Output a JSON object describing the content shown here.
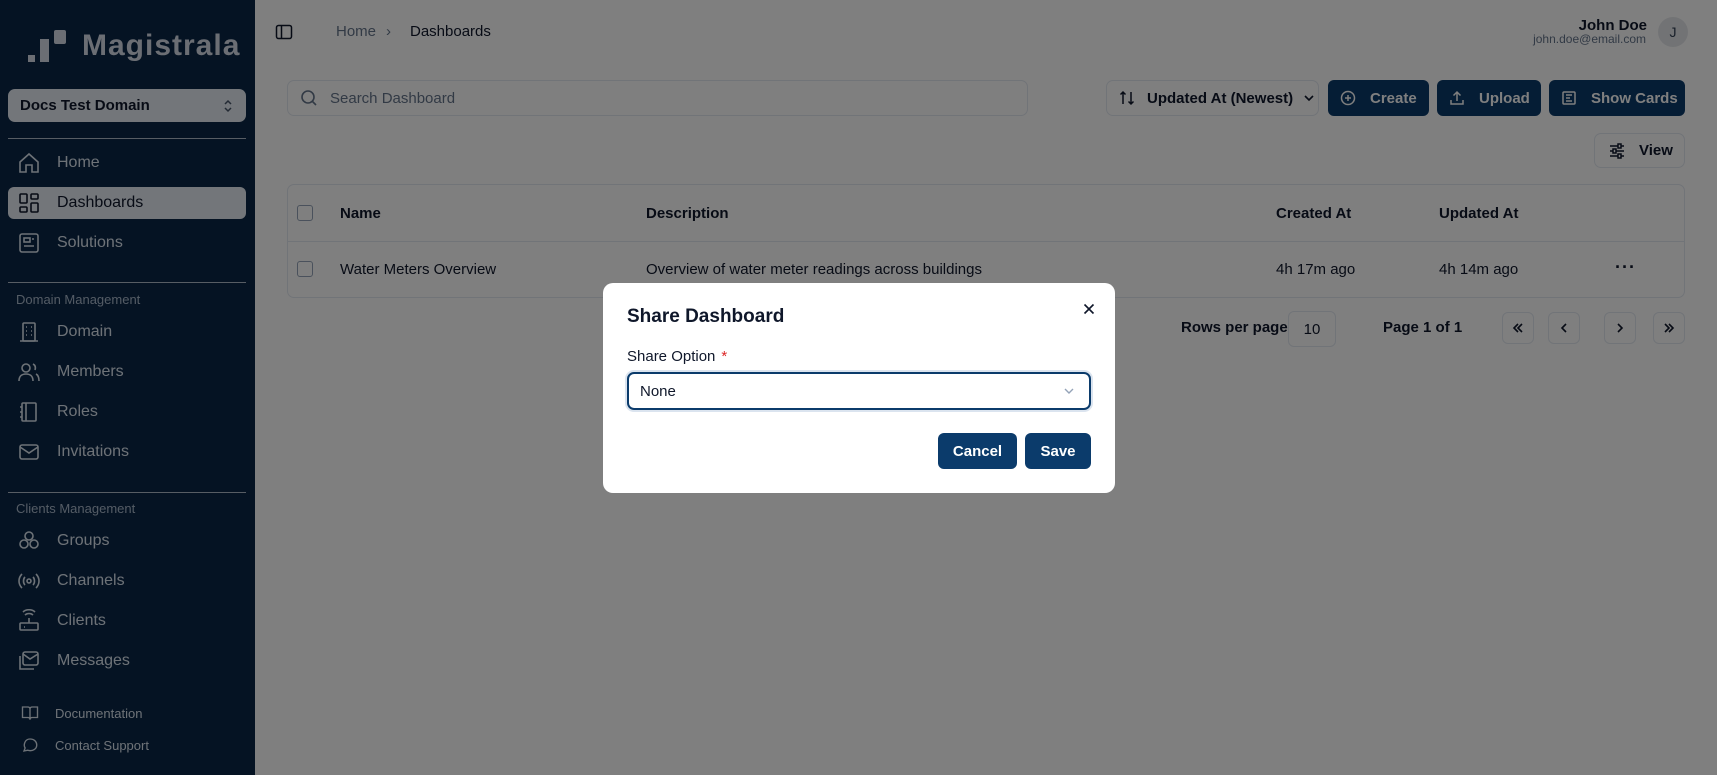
{
  "app": {
    "name": "Magistrala"
  },
  "sidebar": {
    "domain": "Docs Test Domain",
    "items": [
      {
        "label": "Home",
        "icon": "home-icon",
        "active": false
      },
      {
        "label": "Dashboards",
        "icon": "dashboard-icon",
        "active": true
      },
      {
        "label": "Solutions",
        "icon": "solutions-icon",
        "active": false
      }
    ],
    "domain_group": {
      "label": "Domain Management",
      "items": [
        {
          "label": "Domain",
          "icon": "building-icon"
        },
        {
          "label": "Members",
          "icon": "users-icon"
        },
        {
          "label": "Roles",
          "icon": "roles-icon"
        },
        {
          "label": "Invitations",
          "icon": "mail-icon"
        }
      ]
    },
    "clients_group": {
      "label": "Clients Management",
      "items": [
        {
          "label": "Groups",
          "icon": "groups-icon"
        },
        {
          "label": "Channels",
          "icon": "radio-icon"
        },
        {
          "label": "Clients",
          "icon": "router-icon"
        },
        {
          "label": "Messages",
          "icon": "messages-icon"
        }
      ]
    },
    "footer": [
      {
        "label": "Documentation",
        "icon": "book-icon"
      },
      {
        "label": "Contact Support",
        "icon": "chat-icon"
      }
    ]
  },
  "header": {
    "breadcrumb": {
      "home": "Home",
      "separator": "›",
      "current": "Dashboards"
    },
    "user": {
      "name": "John Doe",
      "email": "john.doe@email.com",
      "initial": "J"
    }
  },
  "toolbar": {
    "search_placeholder": "Search Dashboard",
    "sort_label": "Updated At (Newest)",
    "create_label": "Create",
    "upload_label": "Upload",
    "show_cards_label": "Show Cards",
    "view_label": "View"
  },
  "table": {
    "columns": [
      "Name",
      "Description",
      "Created At",
      "Updated At"
    ],
    "rows": [
      {
        "name": "Water Meters Overview",
        "description": "Overview of water meter readings across buildings",
        "created": "4h 17m ago",
        "updated": "4h 14m ago"
      }
    ]
  },
  "pagination": {
    "rows_per_page_label": "Rows per page",
    "rows_per_page": "10",
    "page_label": "Page 1 of 1"
  },
  "dialog": {
    "title": "Share Dashboard",
    "field_label": "Share Option",
    "required_mark": "*",
    "selected": "None",
    "cancel_label": "Cancel",
    "save_label": "Save"
  },
  "colors": {
    "sidebar_bg": "#0b2747",
    "primary": "#0b3b6b",
    "overlay": "rgba(0,0,0,0.5)"
  }
}
